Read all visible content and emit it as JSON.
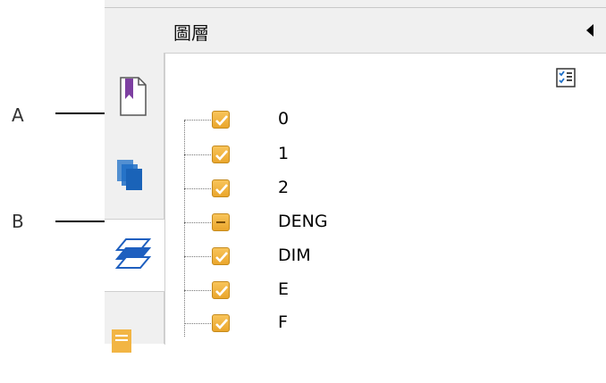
{
  "callouts": [
    {
      "label": "A"
    },
    {
      "label": "B"
    }
  ],
  "panel": {
    "title": "圖層"
  },
  "side_tabs": [
    {
      "icon": "bookmark-icon"
    },
    {
      "icon": "pages-icon"
    },
    {
      "icon": "layers-icon",
      "active": true
    },
    {
      "icon": "annotations-icon"
    }
  ],
  "toolbar": {
    "toggle_all_icon": "checklist-icon"
  },
  "layers": [
    {
      "name": "0",
      "state": "checked"
    },
    {
      "name": "1",
      "state": "checked"
    },
    {
      "name": "2",
      "state": "checked"
    },
    {
      "name": "DENG",
      "state": "partial"
    },
    {
      "name": "DIM",
      "state": "checked"
    },
    {
      "name": "E",
      "state": "checked"
    },
    {
      "name": "F",
      "state": "checked"
    }
  ],
  "colors": {
    "checkbox": "#f2b544",
    "bookmark": "#7d3fa1",
    "pages": "#1e6fc7",
    "layers": "#1e5fbf",
    "annotations": "#f2b544"
  }
}
